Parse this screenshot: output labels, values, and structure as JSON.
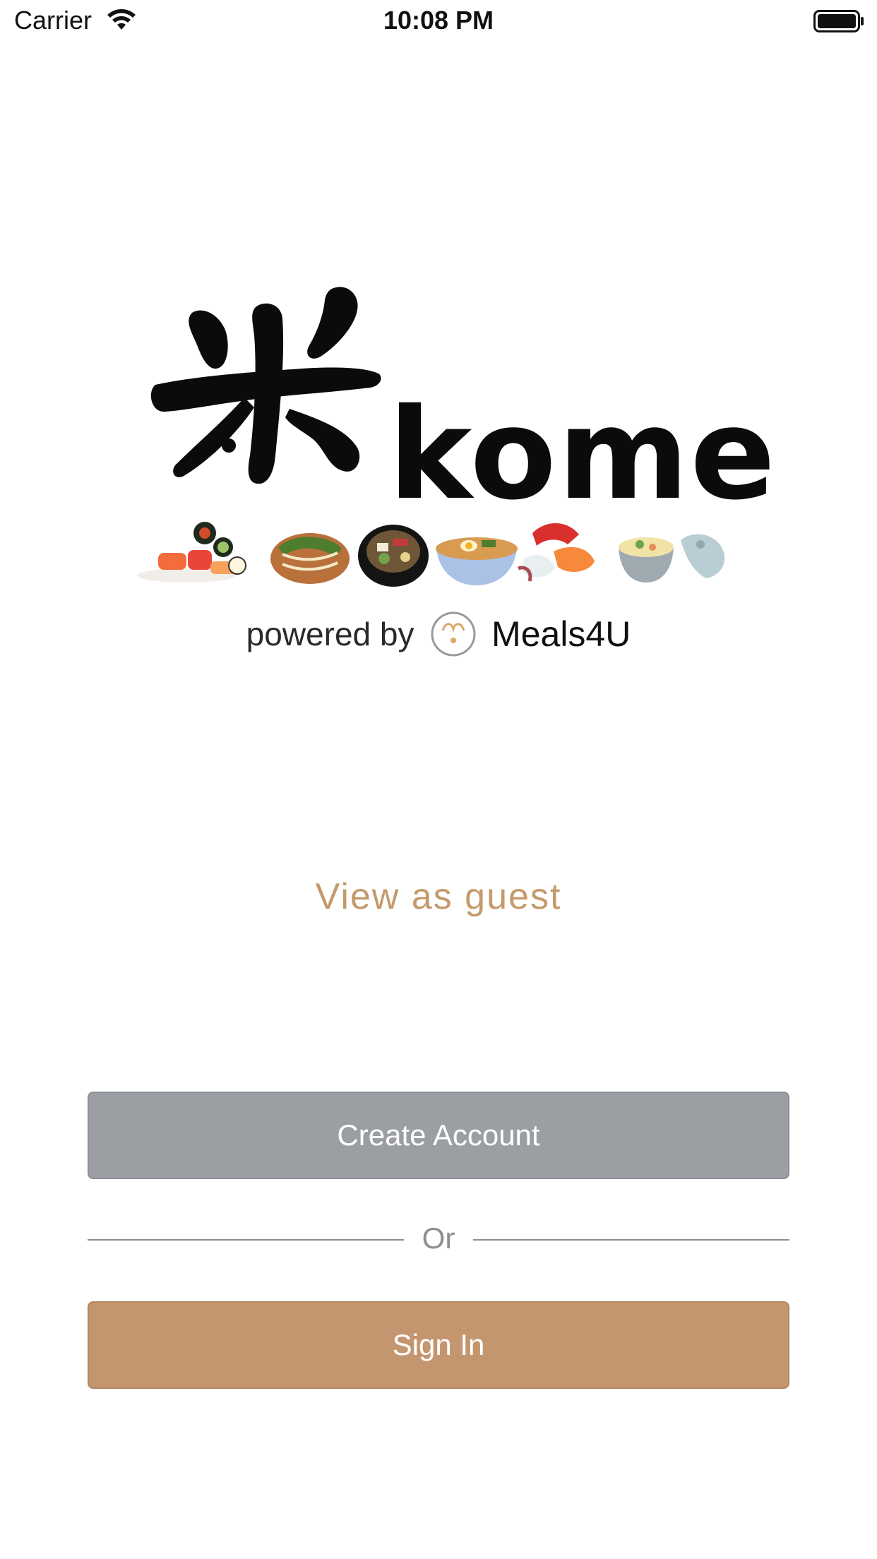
{
  "status_bar": {
    "carrier": "Carrier",
    "time": "10:08 PM",
    "wifi_icon": "wifi-icon",
    "battery_icon": "battery-icon"
  },
  "logo": {
    "kanji": "米",
    "word": "kome",
    "food_icons": [
      "sushi-icon",
      "takoyaki-icon",
      "hotpot-icon",
      "ramen-icon",
      "sashimi-icon",
      "chawanmushi-icon"
    ],
    "powered_by": "powered by",
    "brand": "Meals4U"
  },
  "guest": {
    "label": "View as guest"
  },
  "create_account": {
    "label": "Create Account"
  },
  "divider": {
    "label": "Or"
  },
  "sign_in": {
    "label": "Sign In"
  },
  "colors": {
    "accent": "#c3966f",
    "guest_text": "#c49a6c",
    "create_button": "#9b9ea2",
    "divider": "#8e8e8e"
  }
}
